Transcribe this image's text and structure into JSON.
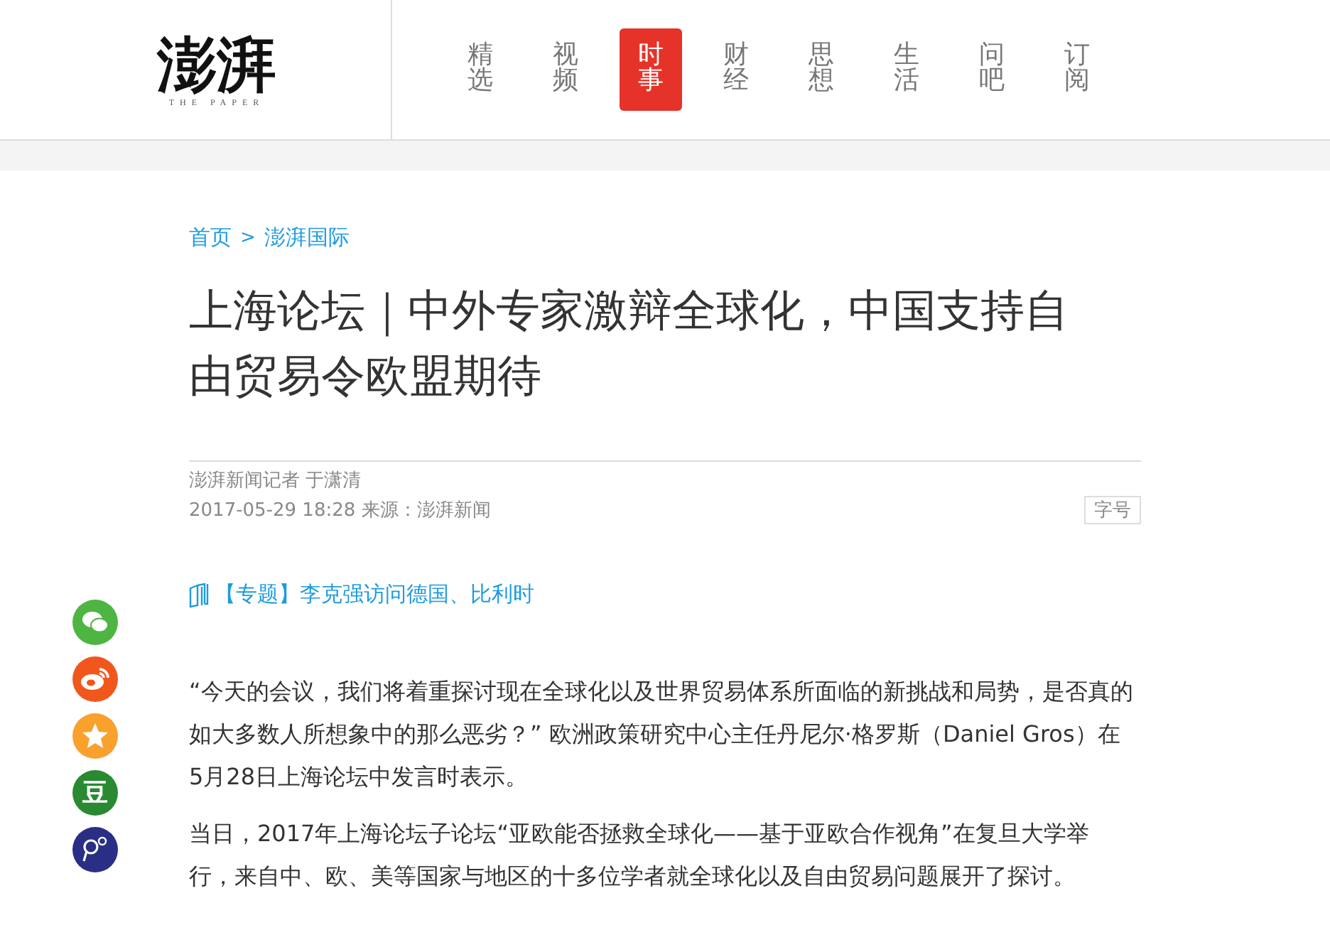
{
  "logo": {
    "title": "澎湃",
    "subtitle": "THE PAPER"
  },
  "nav": [
    {
      "label": "精选",
      "selected": false
    },
    {
      "label": "视频",
      "selected": false
    },
    {
      "label": "时事",
      "selected": true
    },
    {
      "label": "财经",
      "selected": false
    },
    {
      "label": "思想",
      "selected": false
    },
    {
      "label": "生活",
      "selected": false
    },
    {
      "label": "问吧",
      "selected": false
    },
    {
      "label": "订阅",
      "selected": false
    }
  ],
  "breadcrumb": {
    "home": "首页",
    "separator": ">",
    "section": "澎湃国际"
  },
  "article": {
    "title": "上海论坛｜中外专家激辩全球化，中国支持自由贸易令欧盟期待",
    "author": "澎湃新闻记者 于潇清",
    "meta": "2017-05-29 18:28 来源：澎湃新闻",
    "font_size_button": "字号",
    "topic_link": "【专题】李克强访问德国、比利时",
    "paragraphs": [
      "“今天的会议，我们将着重探讨现在全球化以及世界贸易体系所面临的新挑战和局势，是否真的如大多数人所想象中的那么恶劣？” 欧洲政策研究中心主任丹尼尔·格罗斯（Daniel Gros）在5月28日上海论坛中发言时表示。",
      "当日，2017年上海论坛子论坛“亚欧能否拯救全球化——基于亚欧合作视角”在复旦大学举行，来自中、欧、美等国家与地区的十多位学者就全球化以及自由贸易问题展开了探讨。"
    ]
  },
  "share": [
    {
      "kind": "wechat",
      "color": "#4fb542"
    },
    {
      "kind": "weibo",
      "color": "#f1571c"
    },
    {
      "kind": "qzone",
      "color": "#f9a02d"
    },
    {
      "kind": "douban",
      "color": "#2a8a32",
      "label": "豆"
    },
    {
      "kind": "other",
      "color": "#2b2e85"
    }
  ]
}
